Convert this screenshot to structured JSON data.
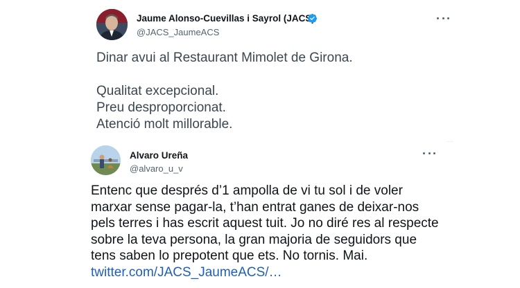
{
  "tweet1": {
    "author_name": "Jaume Alonso-Cuevillas i Sayrol (JACS)",
    "handle": "@JACS_JaumeACS",
    "verified": true,
    "more_icon": "more-horizontal-icon",
    "lines": [
      "Dinar avui al Restaurant Mimolet de Girona.",
      "Qualitat excepcional.",
      "Preu desproporcionat.",
      "Atenció molt millorable."
    ]
  },
  "tweet2": {
    "author_name": "Alvaro Ureña",
    "handle": "@alvaro_u_v",
    "more_icon": "more-horizontal-icon",
    "text": "Entenc que després d’1 ampolla de vi tu sol i de voler marxar sense pagar-la, t’han entrat ganes de deixar-nos pels terres i has escrit aquest tuit. Jo no diré res al respecte sobre la teva persona, la gran majoria de seguidors que tens saben lo prepotent que ets. No tornis. Mai.",
    "link": "twitter.com/JACS_JaumeACS/…"
  },
  "colors": {
    "verified_badge": "#1d9bf0",
    "link": "#1d5fb8",
    "secondary_text": "#536471"
  }
}
